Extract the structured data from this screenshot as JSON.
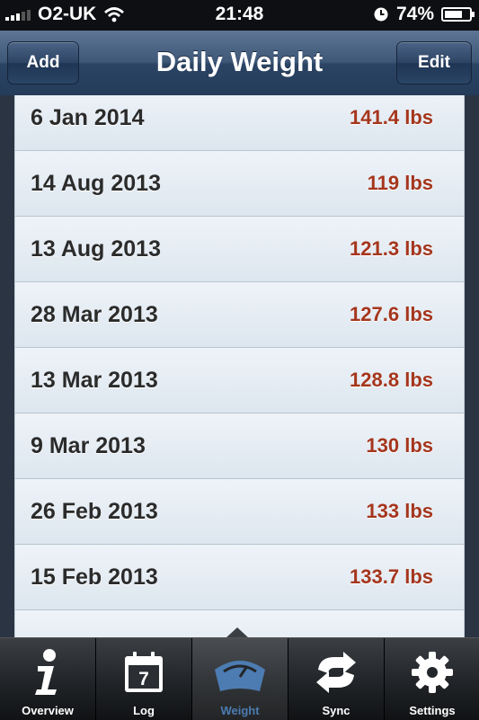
{
  "status_bar": {
    "carrier": "O2-UK",
    "time": "21:48",
    "battery": "74%",
    "battery_level": 0.74
  },
  "nav": {
    "add_label": "Add",
    "title": "Daily Weight",
    "edit_label": "Edit"
  },
  "entries": [
    {
      "date": "6 Jan 2014",
      "weight": "141.4 lbs"
    },
    {
      "date": "14 Aug 2013",
      "weight": "119 lbs"
    },
    {
      "date": "13 Aug 2013",
      "weight": "121.3 lbs"
    },
    {
      "date": "28 Mar 2013",
      "weight": "127.6 lbs"
    },
    {
      "date": "13 Mar 2013",
      "weight": "128.8 lbs"
    },
    {
      "date": "9 Mar 2013",
      "weight": "130 lbs"
    },
    {
      "date": "26 Feb 2013",
      "weight": "133 lbs"
    },
    {
      "date": "15 Feb 2013",
      "weight": "133.7 lbs"
    },
    {
      "date": "",
      "weight": ""
    }
  ],
  "tabs": [
    {
      "label": "Overview",
      "icon": "info-icon"
    },
    {
      "label": "Log",
      "icon": "calendar-icon",
      "icon_text": "7"
    },
    {
      "label": "Weight",
      "icon": "scale-icon"
    },
    {
      "label": "Sync",
      "icon": "sync-icon"
    },
    {
      "label": "Settings",
      "icon": "gear-icon"
    }
  ],
  "active_tab": "Weight",
  "colors": {
    "weight_text": "#a5361d",
    "nav_bar": "#3f5878",
    "active_tab": "#4c7cb1"
  }
}
